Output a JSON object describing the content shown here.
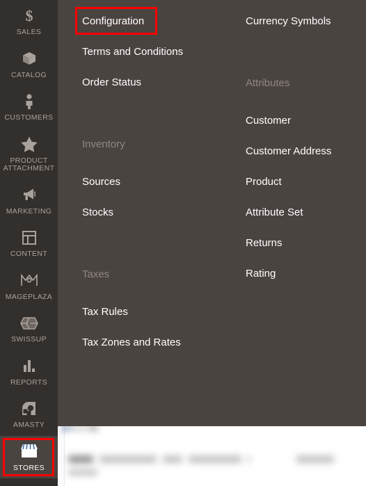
{
  "colors": {
    "rail_bg": "#332f2c",
    "flyout_bg": "#4a4441",
    "active_bg": "#4a4441",
    "link": "#ffffff",
    "section_head": "#8f8781",
    "annotation": "#ff0000"
  },
  "sidebar": {
    "items": [
      {
        "label": "SALES",
        "icon": "dollar-icon",
        "active": false,
        "highlighted": false
      },
      {
        "label": "CATALOG",
        "icon": "box-icon",
        "active": false,
        "highlighted": false
      },
      {
        "label": "CUSTOMERS",
        "icon": "person-icon",
        "active": false,
        "highlighted": false
      },
      {
        "label": "PRODUCT ATTACHMENT",
        "icon": "star-icon",
        "active": false,
        "highlighted": false
      },
      {
        "label": "MARKETING",
        "icon": "megaphone-icon",
        "active": false,
        "highlighted": false
      },
      {
        "label": "CONTENT",
        "icon": "layout-icon",
        "active": false,
        "highlighted": false
      },
      {
        "label": "MAGEPLAZA",
        "icon": "mageplaza-logo-icon",
        "active": false,
        "highlighted": false
      },
      {
        "label": "SWISSUP",
        "icon": "swissup-logo-icon",
        "active": false,
        "highlighted": false
      },
      {
        "label": "REPORTS",
        "icon": "bar-chart-icon",
        "active": false,
        "highlighted": false
      },
      {
        "label": "AMASTY",
        "icon": "amasty-logo-icon",
        "active": false,
        "highlighted": false
      },
      {
        "label": "STORES",
        "icon": "storefront-icon",
        "active": true,
        "highlighted": true
      }
    ]
  },
  "flyout": {
    "column_1": [
      {
        "type": "link",
        "label": "Configuration",
        "annotated": true
      },
      {
        "type": "link",
        "label": "Terms and Conditions",
        "annotated": false
      },
      {
        "type": "link",
        "label": "Order Status",
        "annotated": false
      },
      {
        "type": "heading",
        "label": "Inventory"
      },
      {
        "type": "link",
        "label": "Sources",
        "annotated": false
      },
      {
        "type": "link",
        "label": "Stocks",
        "annotated": false
      },
      {
        "type": "heading",
        "label": "Taxes"
      },
      {
        "type": "link",
        "label": "Tax Rules",
        "annotated": false
      },
      {
        "type": "link",
        "label": "Tax Zones and Rates",
        "annotated": false
      }
    ],
    "column_2": [
      {
        "type": "link",
        "label": "Currency Symbols",
        "annotated": false
      },
      {
        "type": "heading",
        "label": "Attributes"
      },
      {
        "type": "link",
        "label": "Customer",
        "annotated": false
      },
      {
        "type": "link",
        "label": "Customer Address",
        "annotated": false
      },
      {
        "type": "link",
        "label": "Product",
        "annotated": false
      },
      {
        "type": "link",
        "label": "Attribute Set",
        "annotated": false
      },
      {
        "type": "link",
        "label": "Returns",
        "annotated": false
      },
      {
        "type": "link",
        "label": "Rating",
        "annotated": false
      }
    ]
  }
}
